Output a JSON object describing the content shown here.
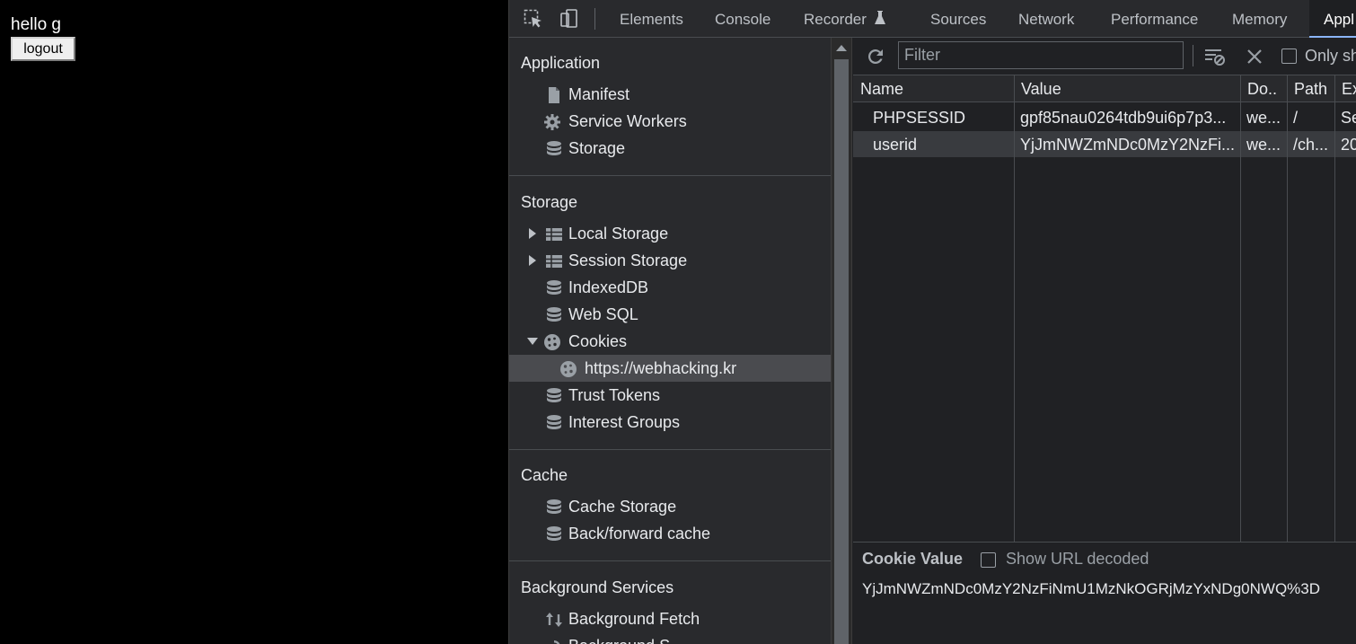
{
  "page": {
    "greeting": "hello g",
    "logout_label": "logout"
  },
  "devtools": {
    "tabs": [
      {
        "label": "Elements"
      },
      {
        "label": "Console"
      },
      {
        "label": "Recorder"
      },
      {
        "label": "Sources"
      },
      {
        "label": "Network"
      },
      {
        "label": "Performance"
      },
      {
        "label": "Memory"
      },
      {
        "label": "Appl"
      }
    ],
    "sidebar": {
      "sections": [
        {
          "title": "Application",
          "items": [
            "Manifest",
            "Service Workers",
            "Storage"
          ]
        },
        {
          "title": "Storage",
          "items": [
            "Local Storage",
            "Session Storage",
            "IndexedDB",
            "Web SQL",
            "Cookies",
            "https://webhacking.kr",
            "Trust Tokens",
            "Interest Groups"
          ]
        },
        {
          "title": "Cache",
          "items": [
            "Cache Storage",
            "Back/forward cache"
          ]
        },
        {
          "title": "Background Services",
          "items": [
            "Background Fetch",
            "Background S"
          ]
        }
      ]
    },
    "toolbar": {
      "filter_placeholder": "Filter",
      "only_show_label": "Only sh"
    },
    "table": {
      "columns": [
        "Name",
        "Value",
        "Do..",
        "Path",
        "Ex"
      ],
      "rows": [
        {
          "name": "PHPSESSID",
          "value": "gpf85nau0264tdb9ui6p7p3...",
          "domain": "we...",
          "path": "/",
          "expires": "Se"
        },
        {
          "name": "userid",
          "value": "YjJmNWZmNDc0MzY2NzFi...",
          "domain": "we...",
          "path": "/ch...",
          "expires": "20"
        }
      ],
      "selected_row": 1
    },
    "cookie_value": {
      "title": "Cookie Value",
      "decode_label": "Show URL decoded",
      "value": "YjJmNWZmNDc0MzY2NzFiNmU1MzNkOGRjMzYxNDg0NWQ%3D"
    }
  }
}
